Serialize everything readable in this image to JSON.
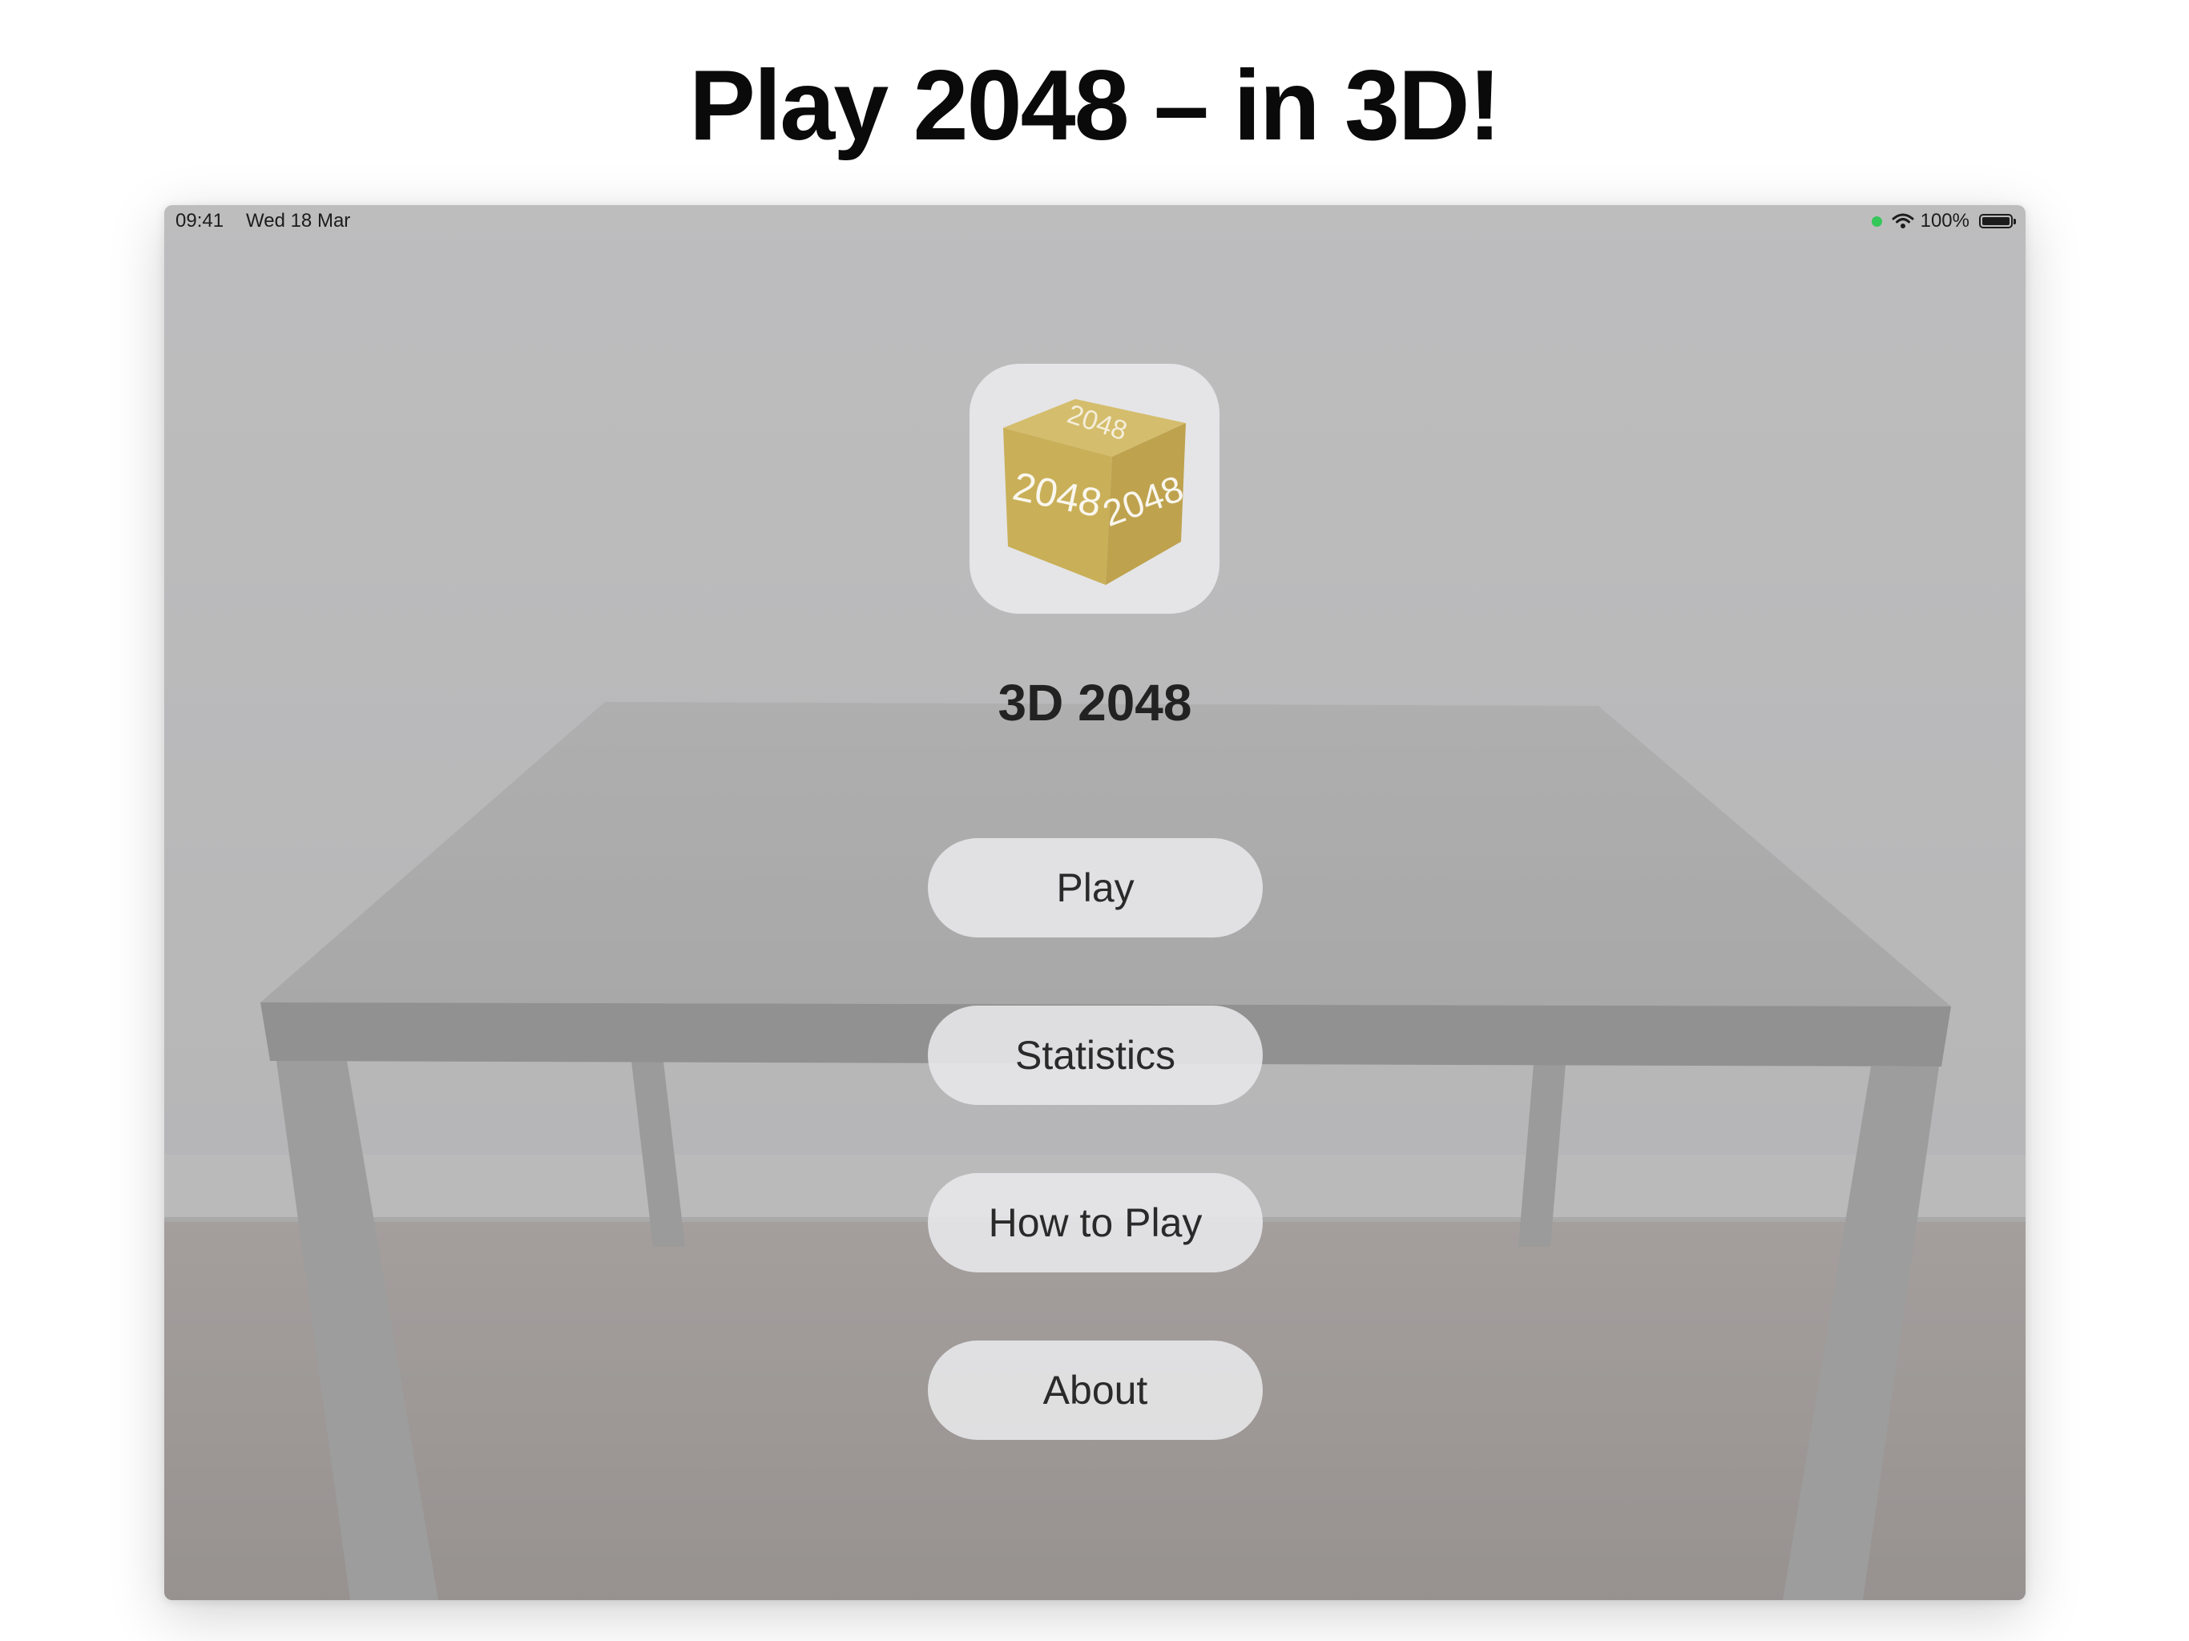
{
  "promo": {
    "headline": "Play 2048 – in 3D!"
  },
  "status_bar": {
    "time": "09:41",
    "date": "Wed 18 Mar",
    "battery": "100%",
    "icons": [
      "camera-in-use-dot",
      "wifi-icon",
      "battery-icon"
    ]
  },
  "app": {
    "icon_tile_text": "2048",
    "title": "3D 2048",
    "icon_color": "#c7ad58"
  },
  "menu": {
    "play": "Play",
    "statistics": "Statistics",
    "how_to_play": "How to Play",
    "about": "About"
  },
  "colors": {
    "overlay": "#6e6e6e",
    "button_bg": "#e8e8ea",
    "status_green": "#34c759"
  }
}
